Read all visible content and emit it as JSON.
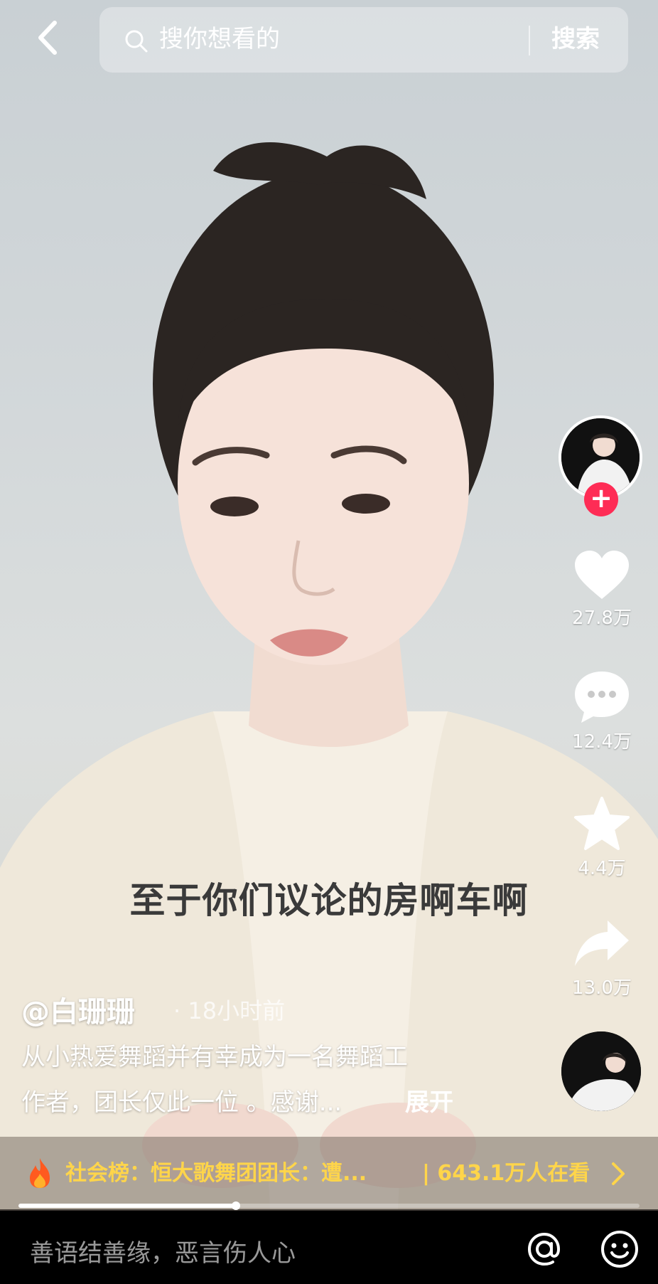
{
  "topbar": {
    "search_placeholder": "搜你想看的",
    "search_button": "搜索"
  },
  "rail": {
    "follow_symbol": "+",
    "like_count": "27.8万",
    "comment_count": "12.4万",
    "favorite_count": "4.4万",
    "share_count": "13.0万"
  },
  "video": {
    "subtitle": "至于你们议论的房啊车啊",
    "author": "@白珊珊",
    "post_time": "· 18小时前",
    "desc_line1": "从小热爱舞蹈并有幸成为一名舞蹈工",
    "desc_line2": "作者，团长仅此一位 。感谢...",
    "expand": "展开",
    "progress": 0.35
  },
  "hot_list": {
    "text": "社会榜：恒大歌舞团团长：遭...",
    "views": "| 643.1万人在看"
  },
  "comment": {
    "placeholder": "善语结善缘，恶言伤人心"
  },
  "colors": {
    "accent_red": "#fe2c55",
    "hot_yellow": "#ffd54a"
  },
  "icons": [
    "back-arrow-icon",
    "search-icon",
    "heart-icon",
    "comment-icon",
    "star-icon",
    "share-icon",
    "fire-icon",
    "chevron-right-icon",
    "at-icon",
    "emoji-icon"
  ]
}
